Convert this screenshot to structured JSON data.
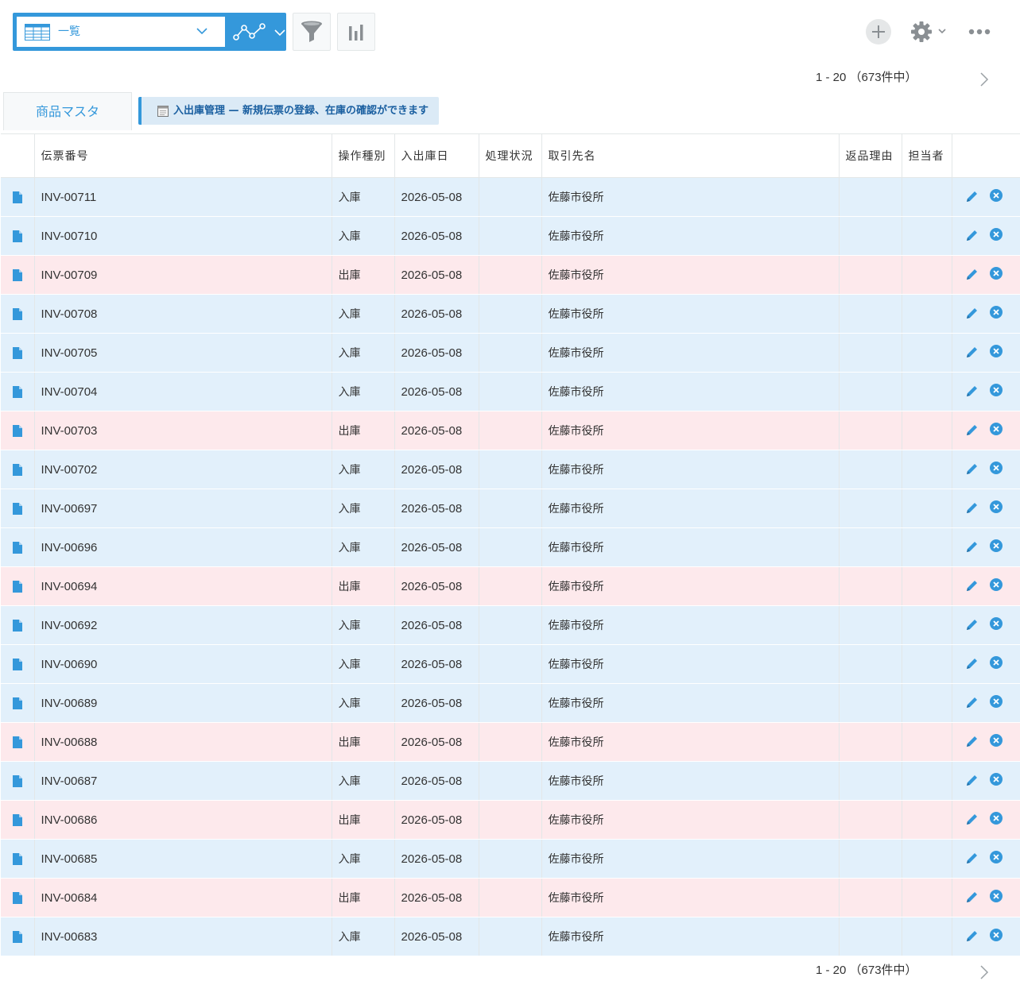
{
  "toolbar": {
    "view_label": "一覧",
    "accent_color": "#3498db"
  },
  "pager": {
    "range_label": "1 - 20 （673件中）"
  },
  "tabs": {
    "master_label": "商品マスタ",
    "notice_label": "入出庫管理 — 新規伝票の登録、在庫の確認ができます"
  },
  "table": {
    "headers": [
      "伝票番号",
      "操作種別",
      "入出庫日",
      "処理状況",
      "取引先名",
      "返品理由",
      "担当者"
    ],
    "row_colors": {
      "入庫": "#e2f0fb",
      "出庫": "#fde9ec"
    },
    "rows": [
      {
        "id": "INV-00711",
        "type": "入庫",
        "date": "2026-05-08",
        "status": "",
        "client": "佐藤市役所",
        "reason": "",
        "owner": ""
      },
      {
        "id": "INV-00710",
        "type": "入庫",
        "date": "2026-05-08",
        "status": "",
        "client": "佐藤市役所",
        "reason": "",
        "owner": ""
      },
      {
        "id": "INV-00709",
        "type": "出庫",
        "date": "2026-05-08",
        "status": "",
        "client": "佐藤市役所",
        "reason": "",
        "owner": ""
      },
      {
        "id": "INV-00708",
        "type": "入庫",
        "date": "2026-05-08",
        "status": "",
        "client": "佐藤市役所",
        "reason": "",
        "owner": ""
      },
      {
        "id": "INV-00705",
        "type": "入庫",
        "date": "2026-05-08",
        "status": "",
        "client": "佐藤市役所",
        "reason": "",
        "owner": ""
      },
      {
        "id": "INV-00704",
        "type": "入庫",
        "date": "2026-05-08",
        "status": "",
        "client": "佐藤市役所",
        "reason": "",
        "owner": ""
      },
      {
        "id": "INV-00703",
        "type": "出庫",
        "date": "2026-05-08",
        "status": "",
        "client": "佐藤市役所",
        "reason": "",
        "owner": ""
      },
      {
        "id": "INV-00702",
        "type": "入庫",
        "date": "2026-05-08",
        "status": "",
        "client": "佐藤市役所",
        "reason": "",
        "owner": ""
      },
      {
        "id": "INV-00697",
        "type": "入庫",
        "date": "2026-05-08",
        "status": "",
        "client": "佐藤市役所",
        "reason": "",
        "owner": ""
      },
      {
        "id": "INV-00696",
        "type": "入庫",
        "date": "2026-05-08",
        "status": "",
        "client": "佐藤市役所",
        "reason": "",
        "owner": ""
      },
      {
        "id": "INV-00694",
        "type": "出庫",
        "date": "2026-05-08",
        "status": "",
        "client": "佐藤市役所",
        "reason": "",
        "owner": ""
      },
      {
        "id": "INV-00692",
        "type": "入庫",
        "date": "2026-05-08",
        "status": "",
        "client": "佐藤市役所",
        "reason": "",
        "owner": ""
      },
      {
        "id": "INV-00690",
        "type": "入庫",
        "date": "2026-05-08",
        "status": "",
        "client": "佐藤市役所",
        "reason": "",
        "owner": ""
      },
      {
        "id": "INV-00689",
        "type": "入庫",
        "date": "2026-05-08",
        "status": "",
        "client": "佐藤市役所",
        "reason": "",
        "owner": ""
      },
      {
        "id": "INV-00688",
        "type": "出庫",
        "date": "2026-05-08",
        "status": "",
        "client": "佐藤市役所",
        "reason": "",
        "owner": ""
      },
      {
        "id": "INV-00687",
        "type": "入庫",
        "date": "2026-05-08",
        "status": "",
        "client": "佐藤市役所",
        "reason": "",
        "owner": ""
      },
      {
        "id": "INV-00686",
        "type": "出庫",
        "date": "2026-05-08",
        "status": "",
        "client": "佐藤市役所",
        "reason": "",
        "owner": ""
      },
      {
        "id": "INV-00685",
        "type": "入庫",
        "date": "2026-05-08",
        "status": "",
        "client": "佐藤市役所",
        "reason": "",
        "owner": ""
      },
      {
        "id": "INV-00684",
        "type": "出庫",
        "date": "2026-05-08",
        "status": "",
        "client": "佐藤市役所",
        "reason": "",
        "owner": ""
      },
      {
        "id": "INV-00683",
        "type": "入庫",
        "date": "2026-05-08",
        "status": "",
        "client": "佐藤市役所",
        "reason": "",
        "owner": ""
      }
    ]
  },
  "icons": {
    "row_detail": "document-icon",
    "row_edit": "pencil-icon",
    "row_delete": "delete-circle-icon",
    "filter": "filter-icon",
    "graph": "bar-chart-icon",
    "add": "plus-icon",
    "settings": "gear-icon",
    "more": "more-dots-icon",
    "next": "chevron-right-icon"
  }
}
